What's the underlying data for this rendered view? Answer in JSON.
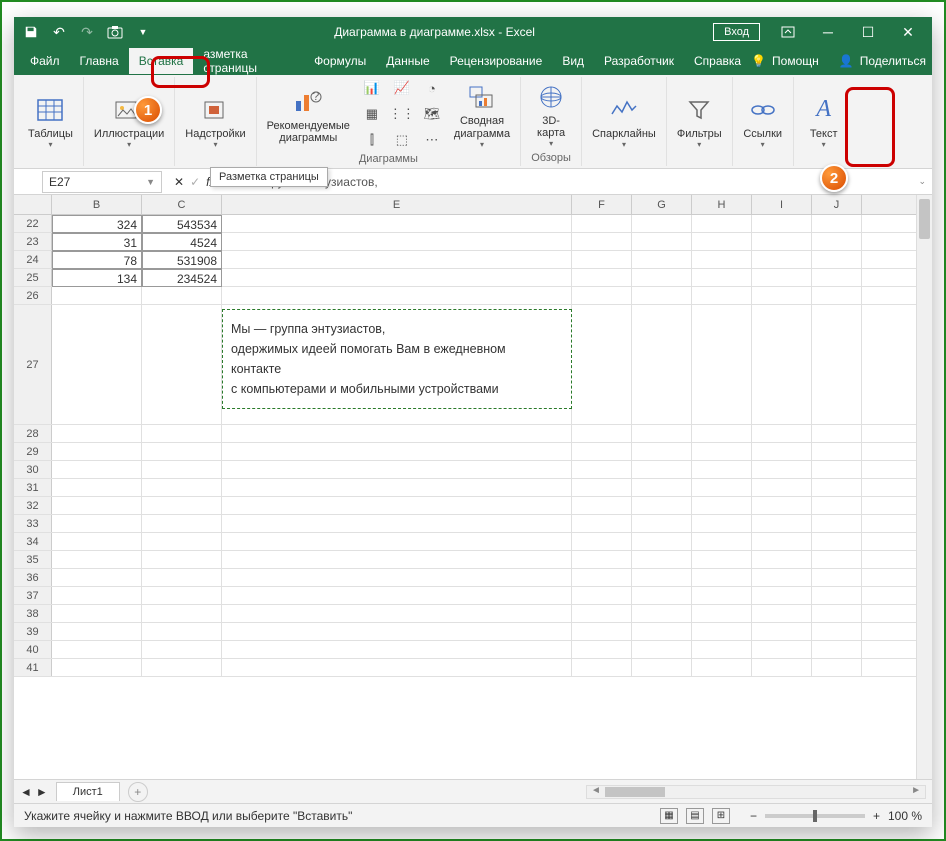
{
  "title": "Диаграмма в диаграмме.xlsx - Excel",
  "login": "Вход",
  "tabs": {
    "file": "Файл",
    "home": "Главна",
    "insert": "Вставка",
    "pagelayout": "азметка страницы",
    "formulas": "Формулы",
    "data": "Данные",
    "review": "Рецензирование",
    "view": "Вид",
    "developer": "Разработчик",
    "help": "Справка"
  },
  "right_actions": {
    "tell": "Помощн",
    "share": "Поделиться"
  },
  "ribbon": {
    "tables": "Таблицы",
    "illustrations": "Иллюстрации",
    "addins": "Надстройки",
    "rec_charts": "Рекомендуемые\nдиаграммы",
    "charts_group": "Диаграммы",
    "pivot": "Сводная\nдиаграмма",
    "map3d": "3D-\nкарта",
    "tours_group": "Обзоры",
    "sparklines": "Спарклайны",
    "filters": "Фильтры",
    "links": "Ссылки",
    "text": "Текст"
  },
  "tooltip": "Разметка страницы",
  "namebox": "E27",
  "formula": "Мы — группа энтузиастов,",
  "columns": [
    "B",
    "C",
    "E",
    "F",
    "G",
    "H",
    "I",
    "J"
  ],
  "col_widths": {
    "B": 90,
    "C": 80,
    "E": 350,
    "F": 60,
    "G": 60,
    "H": 60,
    "I": 60,
    "J": 50
  },
  "rows_top": [
    {
      "n": 22,
      "B": "324",
      "C": "543534"
    },
    {
      "n": 23,
      "B": "31",
      "C": "4524"
    },
    {
      "n": 24,
      "B": "78",
      "C": "531908"
    },
    {
      "n": 25,
      "B": "134",
      "C": "234524"
    }
  ],
  "empty_rows_before": [
    26
  ],
  "textbox_row": 27,
  "empty_rows_after": [
    28,
    29,
    30,
    31,
    32,
    33,
    34,
    35,
    36,
    37,
    38,
    39,
    40,
    41
  ],
  "textbox": {
    "lines": [
      "Мы — группа энтузиастов,",
      "одержимых идеей помогать Вам в ежедневном",
      "контакте",
      "с компьютерами и мобильными устройствами"
    ]
  },
  "sheet": "Лист1",
  "status": "Укажите ячейку и нажмите ВВОД или выберите \"Вставить\"",
  "zoom": "100 %",
  "badges": {
    "one": "1",
    "two": "2"
  }
}
